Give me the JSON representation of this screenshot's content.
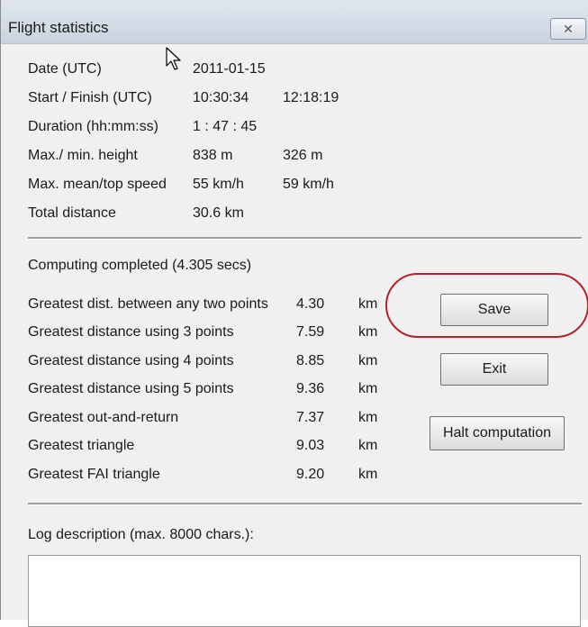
{
  "window": {
    "title": "Flight statistics",
    "close_glyph": "✕"
  },
  "stats": [
    {
      "label": "Date (UTC)",
      "values": [
        "2011-01-15"
      ]
    },
    {
      "label": "Start / Finish (UTC)",
      "values": [
        "10:30:34",
        "12:18:19"
      ]
    },
    {
      "label": "Duration (hh:mm:ss)",
      "values": [
        "1 : 47 : 45"
      ]
    },
    {
      "label": "Max./ min. height",
      "values": [
        "838 m",
        "326 m"
      ]
    },
    {
      "label": "Max. mean/top speed",
      "values": [
        "55 km/h",
        "59 km/h"
      ]
    },
    {
      "label": "Total distance",
      "values": [
        "30.6 km"
      ]
    }
  ],
  "computing_status": "Computing completed (4.305 secs)",
  "distances": [
    {
      "label": "Greatest dist. between any two points",
      "value": "4.30",
      "unit": "km"
    },
    {
      "label": "Greatest distance using 3 points",
      "value": "7.59",
      "unit": "km"
    },
    {
      "label": "Greatest distance using 4 points",
      "value": "8.85",
      "unit": "km"
    },
    {
      "label": "Greatest distance using 5 points",
      "value": "9.36",
      "unit": "km"
    },
    {
      "label": "Greatest out-and-return",
      "value": "7.37",
      "unit": "km"
    },
    {
      "label": "Greatest triangle",
      "value": "9.03",
      "unit": "km"
    },
    {
      "label": "Greatest FAI triangle",
      "value": "9.20",
      "unit": "km"
    }
  ],
  "buttons": {
    "save": "Save",
    "exit": "Exit",
    "halt": "Halt computation"
  },
  "log": {
    "label": "Log description (max. 8000 chars.):",
    "value": ""
  },
  "colors": {
    "highlight_ring": "#b5222a",
    "dialog_bg": "#f0f0f0"
  },
  "icons": {
    "cursor": "mouse-pointer-icon",
    "close": "close-icon"
  }
}
